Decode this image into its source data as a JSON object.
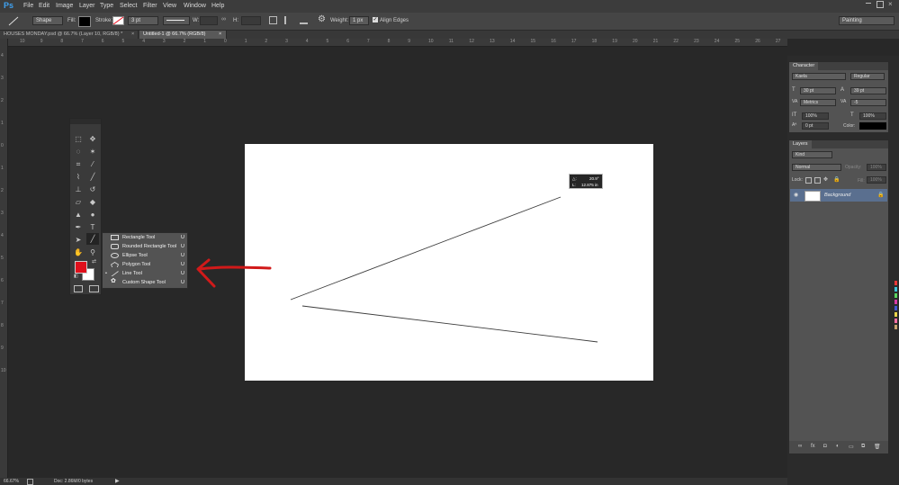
{
  "menubar": {
    "logo": "Ps",
    "items": [
      "File",
      "Edit",
      "Image",
      "Layer",
      "Type",
      "Select",
      "Filter",
      "View",
      "Window",
      "Help"
    ]
  },
  "options": {
    "mode": "Shape",
    "fill_label": "Fill:",
    "stroke_label": "Stroke:",
    "stroke_width": "3 pt",
    "w_label": "W:",
    "h_label": "H:",
    "weight_label": "Weight:",
    "weight_value": "1 px",
    "align_edges_label": "Align Edges",
    "workspace": "Painting"
  },
  "tabs": [
    {
      "label": "HOUSES MONDAY.psd @ 66.7% (Layer 10, RGB/8) *",
      "close": "×"
    },
    {
      "label": "Untitled-1 @ 66.7% (RGB/8)",
      "close": "×"
    }
  ],
  "ruler": {
    "top_numbers": [
      "10",
      "9",
      "8",
      "7",
      "6",
      "5",
      "4",
      "3",
      "2",
      "1",
      "0",
      "1",
      "2",
      "3",
      "4",
      "5",
      "6",
      "7",
      "8",
      "9",
      "10",
      "11",
      "12",
      "13",
      "14",
      "15",
      "16",
      "17",
      "18",
      "19",
      "20",
      "21",
      "22",
      "23",
      "24",
      "25",
      "26",
      "27"
    ],
    "left_numbers": [
      "4",
      "3",
      "2",
      "1",
      "0",
      "1",
      "2",
      "3",
      "4",
      "5",
      "6",
      "7",
      "8",
      "9",
      "10"
    ]
  },
  "measure": {
    "angle": "20.9°",
    "length": "12.875 in",
    "angle_icon": "△:",
    "length_icon": "L:"
  },
  "flyout": {
    "items": [
      {
        "label": "Rectangle Tool",
        "key": "U",
        "selected": false
      },
      {
        "label": "Rounded Rectangle Tool",
        "key": "U",
        "selected": false
      },
      {
        "label": "Ellipse Tool",
        "key": "U",
        "selected": false
      },
      {
        "label": "Polygon Tool",
        "key": "U",
        "selected": false
      },
      {
        "label": "Line Tool",
        "key": "U",
        "selected": true
      },
      {
        "label": "Custom Shape Tool",
        "key": "U",
        "selected": false
      }
    ]
  },
  "character": {
    "title": "Character",
    "font_family": "Kaela",
    "font_style": "Regular",
    "size": "30 pt",
    "leading": "39 pt",
    "kerning": "Metrics",
    "tracking": "-5",
    "vscale": "100%",
    "hscale": "100%",
    "baseline": "0 pt",
    "color_label": "Color:"
  },
  "layers": {
    "title": "Layers",
    "filter": "Kind",
    "blend": "Normal",
    "opacity_label": "Opacity:",
    "opacity": "100%",
    "lock_label": "Lock:",
    "fill_label": "Fill:",
    "fill": "100%",
    "layer_name": "Background"
  },
  "status": {
    "zoom": "66.67%",
    "doc": "Doc: 2.86M/0 bytes"
  },
  "colors": {
    "foreground": "#e0101c",
    "background": "#ffffff",
    "annotation_arrow": "#d11a1a",
    "layer_highlight": "#5a6f8f"
  },
  "swatch_colors": [
    "#e93838",
    "#3ec4d9",
    "#5ad45f",
    "#d93aa6",
    "#4457cf",
    "#e8d34b",
    "#ff6fa5",
    "#c8a26e"
  ]
}
